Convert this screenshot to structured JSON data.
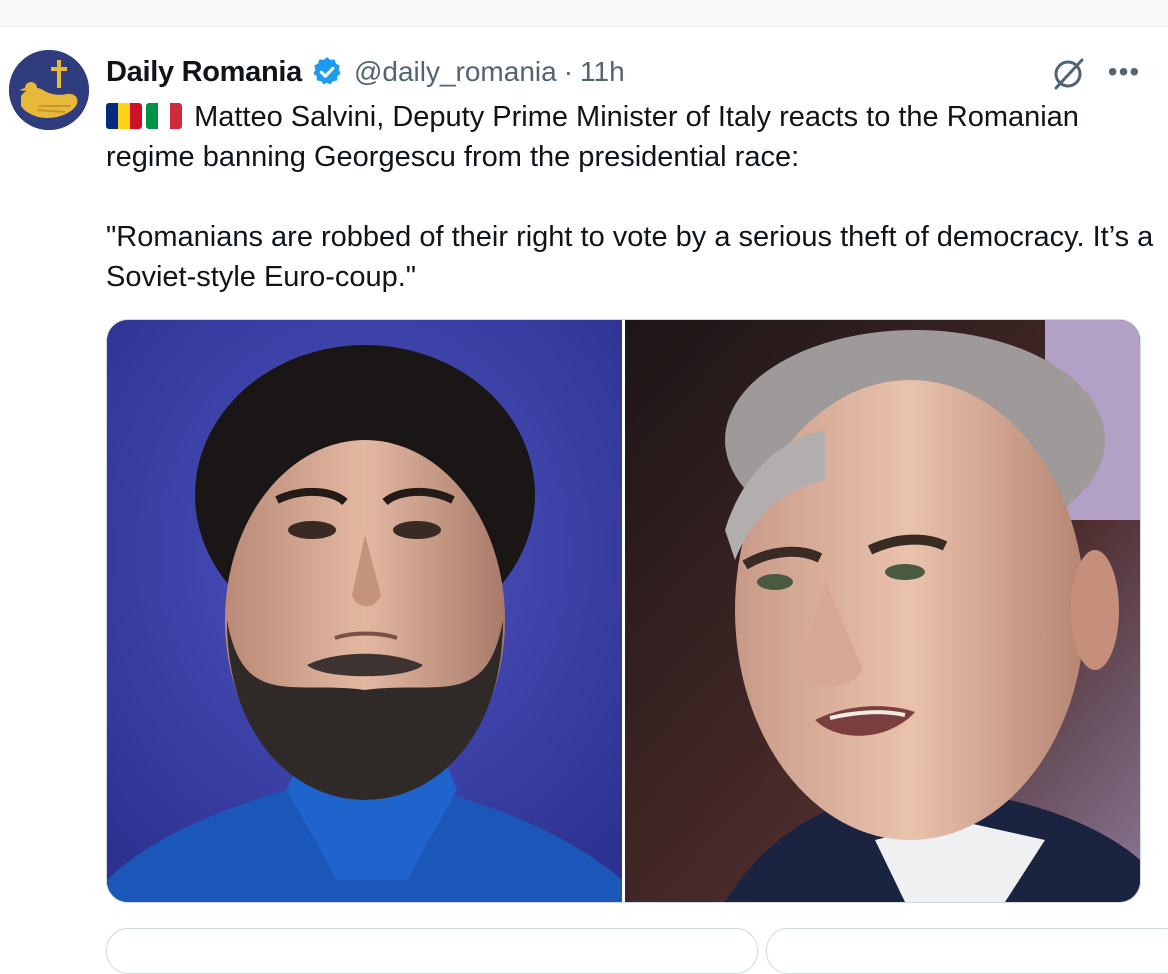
{
  "tweet": {
    "author_name": "Daily Romania",
    "handle": "@daily_romania",
    "separator": "·",
    "time": "11h",
    "more_label": "•••",
    "flags": [
      "romania-flag-icon",
      "italy-flag-icon"
    ],
    "text_line1": "Matteo Salvini, Deputy Prime Minister of Italy reacts to the Romanian regime banning Georgescu from the presidential race:",
    "quote": "\"Romanians are robbed of their right to vote by a serious theft of democracy. It’s a Soviet-style Euro-coup.\""
  },
  "colors": {
    "verified": "#1d9bf0",
    "secondary_text": "#536471",
    "avatar_bg": "#2f3c7e",
    "avatar_bird": "#e7b83a"
  },
  "media": {
    "count": 2
  }
}
